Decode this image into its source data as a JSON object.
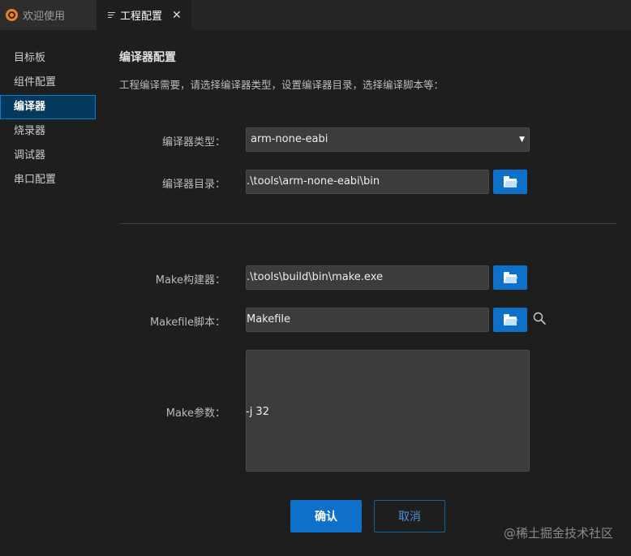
{
  "tabs": [
    {
      "label": "欢迎使用",
      "icon": "app-logo-icon",
      "active": false
    },
    {
      "label": "工程配置",
      "icon": "list-icon",
      "active": true
    }
  ],
  "sidebar": {
    "items": [
      {
        "label": "目标板"
      },
      {
        "label": "组件配置"
      },
      {
        "label": "编译器",
        "active": true
      },
      {
        "label": "烧录器"
      },
      {
        "label": "调试器"
      },
      {
        "label": "串口配置"
      }
    ]
  },
  "main": {
    "title": "编译器配置",
    "description": "工程编译需要，请选择编译器类型，设置编译器目录，选择编译脚本等：",
    "compiler_type": {
      "label": "编译器类型：",
      "value": "arm-none-eabi"
    },
    "compiler_dir": {
      "label": "编译器目录：",
      "value": ".\\tools\\arm-none-eabi\\bin"
    },
    "make_builder": {
      "label": "Make构建器：",
      "value": ".\\tools\\build\\bin\\make.exe"
    },
    "makefile": {
      "label": "Makefile脚本：",
      "value": "Makefile"
    },
    "make_args": {
      "label": "Make参数：",
      "value": "-j 32"
    },
    "ok_label": "确认",
    "cancel_label": "取消"
  },
  "watermark": "@稀土掘金技术社区",
  "colors": {
    "accent": "#0e70c8",
    "background": "#1e1e1e",
    "active_border": "#007fd4"
  }
}
